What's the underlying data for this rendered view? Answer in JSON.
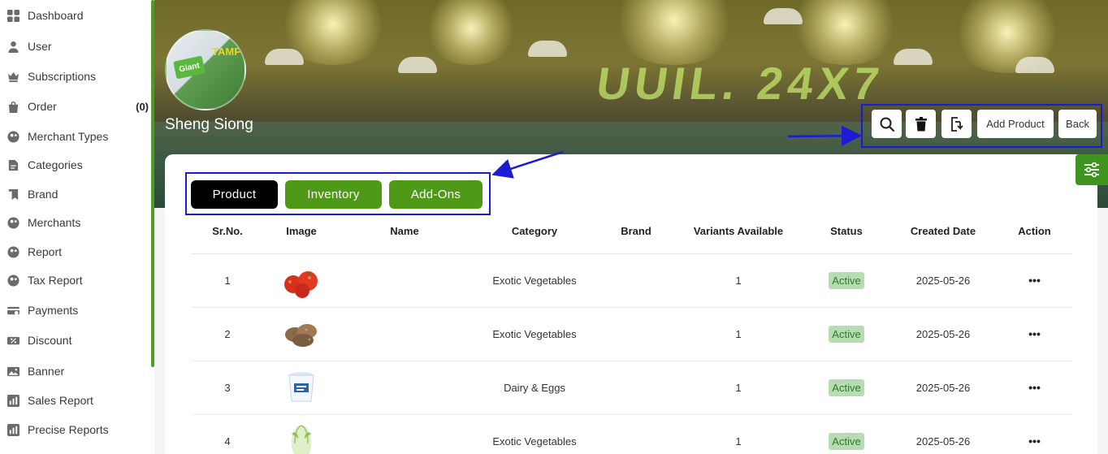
{
  "sidebar": {
    "items": [
      {
        "label": "Dashboard",
        "icon": "dashboard-icon",
        "count": ""
      },
      {
        "label": "User",
        "icon": "user-icon",
        "count": ""
      },
      {
        "label": "Subscriptions",
        "icon": "crown-icon",
        "count": ""
      },
      {
        "label": "Order",
        "icon": "bag-icon",
        "count": "(0)"
      },
      {
        "label": "Merchant Types",
        "icon": "merchant-types-icon",
        "count": ""
      },
      {
        "label": "Categories",
        "icon": "document-icon",
        "count": ""
      },
      {
        "label": "Brand",
        "icon": "bookmark-icon",
        "count": ""
      },
      {
        "label": "Merchants",
        "icon": "merchants-icon",
        "count": ""
      },
      {
        "label": "Report",
        "icon": "report-icon",
        "count": ""
      },
      {
        "label": "Tax Report",
        "icon": "tax-report-icon",
        "count": ""
      },
      {
        "label": "Payments",
        "icon": "payments-icon",
        "count": ""
      },
      {
        "label": "Discount",
        "icon": "discount-icon",
        "count": ""
      },
      {
        "label": "Banner",
        "icon": "image-icon",
        "count": ""
      },
      {
        "label": "Sales Report",
        "icon": "chart-icon",
        "count": ""
      },
      {
        "label": "Precise Reports",
        "icon": "chart-icon",
        "count": ""
      }
    ]
  },
  "store": {
    "name": "Sheng Siong",
    "logo_text_1": "Giant",
    "logo_text_2": "TAMP",
    "banner_sign": "UUIL. 24X7"
  },
  "actions": {
    "search_icon": "search-icon",
    "delete_icon": "trash-icon",
    "export_icon": "export-icon",
    "add_product_label": "Add Product",
    "back_label": "Back",
    "filter_icon": "sliders-icon"
  },
  "tabs": [
    {
      "label": "Product",
      "active": true
    },
    {
      "label": "Inventory",
      "active": false
    },
    {
      "label": "Add-Ons",
      "active": false
    }
  ],
  "table": {
    "headers": [
      "Sr.No.",
      "Image",
      "Name",
      "Category",
      "Brand",
      "Variants Available",
      "Status",
      "Created Date",
      "Action"
    ],
    "rows": [
      {
        "sr": "1",
        "image": "tomatoes",
        "name": "",
        "category": "Exotic Vegetables",
        "brand": "",
        "variants": "1",
        "status": "Active",
        "date": "2025-05-26",
        "action": "•••"
      },
      {
        "sr": "2",
        "image": "patties",
        "name": "",
        "category": "Exotic Vegetables",
        "brand": "",
        "variants": "1",
        "status": "Active",
        "date": "2025-05-26",
        "action": "•••"
      },
      {
        "sr": "3",
        "image": "yogurt-cup",
        "name": "",
        "category": "Dairy & Eggs",
        "brand": "",
        "variants": "1",
        "status": "Active",
        "date": "2025-05-26",
        "action": "•••"
      },
      {
        "sr": "4",
        "image": "cabbage",
        "name": "",
        "category": "Exotic Vegetables",
        "brand": "",
        "variants": "1",
        "status": "Active",
        "date": "2025-05-26",
        "action": "•••"
      }
    ]
  },
  "colors": {
    "accent_green": "#4e9a2a",
    "active_tab": "#000000",
    "annotation_blue": "#1b1bd6",
    "status_bg": "#b6ddb1"
  }
}
